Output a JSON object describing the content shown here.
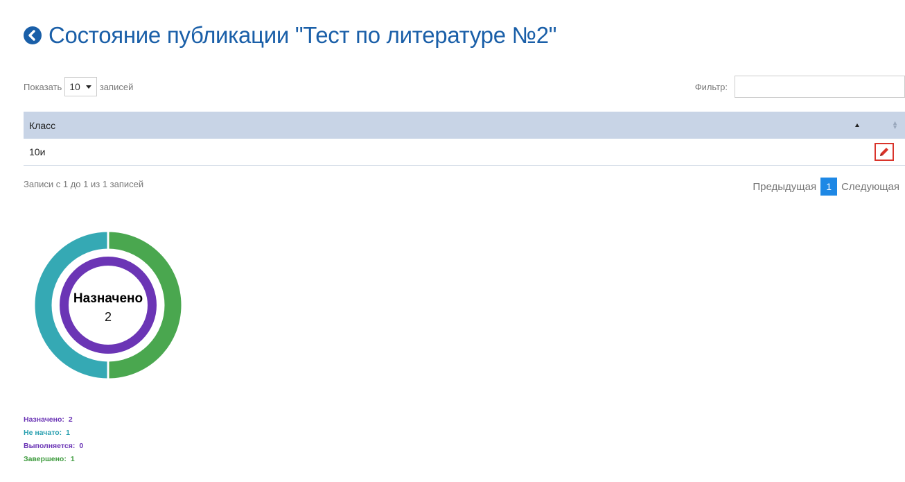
{
  "page": {
    "title": "Состояние публикации \"Тест по литературе №2\""
  },
  "length": {
    "show_label": "Показать",
    "value": "10",
    "records_label": "записей"
  },
  "filter": {
    "label": "Фильтр:",
    "value": ""
  },
  "table": {
    "columns": [
      "Класс"
    ],
    "rows": [
      {
        "class": "10и"
      }
    ]
  },
  "info": {
    "text": "Записи с 1 до 1 из 1 записей"
  },
  "pagination": {
    "prev": "Предыдущая",
    "current": "1",
    "next": "Следующая"
  },
  "chart_data": {
    "type": "pie",
    "center_label": "Назначено",
    "center_value": "2",
    "outer_ring": [
      {
        "label": "Не начато:",
        "value": 1,
        "color": "#35a9b4"
      },
      {
        "label": "Завершено:",
        "value": 1,
        "color": "#4aa74f"
      }
    ],
    "inner_ring": [
      {
        "label": "Назначено:",
        "value": 2,
        "color": "#6b35b5"
      }
    ],
    "legend": [
      {
        "label": "Назначено:",
        "value": "2",
        "color": "#6b35b5"
      },
      {
        "label": "Не начато:",
        "value": "1",
        "color": "#2aa0b0"
      },
      {
        "label": "Выполняется:",
        "value": "0",
        "color": "#6b35b5"
      },
      {
        "label": "Завершено:",
        "value": "1",
        "color": "#3e9b3e"
      }
    ]
  },
  "colors": {
    "title": "#1a5fa8",
    "header": "#c8d4e6",
    "active_page": "#1e88e5",
    "edit_border": "#d9342b"
  }
}
